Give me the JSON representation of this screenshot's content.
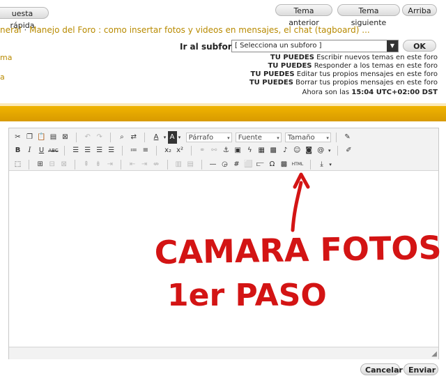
{
  "top_buttons": {
    "quick_reply": "uesta rápida",
    "previous": "Tema anterior",
    "next": "Tema siguiente",
    "up": "Arriba"
  },
  "breadcrumb": {
    "first": "neral",
    "separator": "·",
    "forum": "Manejo del Foro : como insertar fotos y videos en mensajes, el chat (tagboard) ..."
  },
  "left_fragments": [
    "ma",
    "a"
  ],
  "subforum": {
    "label": "Ir al subforo:",
    "selected": "[ Selecciona un subforo ]",
    "ok_label": "OK"
  },
  "permissions": [
    {
      "strong": "TU PUEDES",
      "rest": "Escribir nuevos temas en este foro"
    },
    {
      "strong": "TU PUEDES",
      "rest": "Responder a los temas en este foro"
    },
    {
      "strong": "TU PUEDES",
      "rest": "Editar tus propios mensajes en este foro"
    },
    {
      "strong": "TU PUEDES",
      "rest": "Borrar tus propios mensajes en este foro"
    }
  ],
  "time": {
    "prefix": "Ahora son las",
    "value": "15:04 UTC+02:00 DST"
  },
  "toolbar": {
    "paragraph": "Párrafo",
    "font": "Fuente",
    "size": "Tamaño",
    "html": "HTML"
  },
  "annotation": {
    "line1": "CAMARA FOTOS",
    "line2": "1er PASO"
  },
  "bottom_buttons": {
    "cancel": "Cancelar",
    "send": "Enviar"
  },
  "colors": {
    "accent": "#e0a300",
    "link": "#b88a00",
    "annotation": "#d31414"
  }
}
